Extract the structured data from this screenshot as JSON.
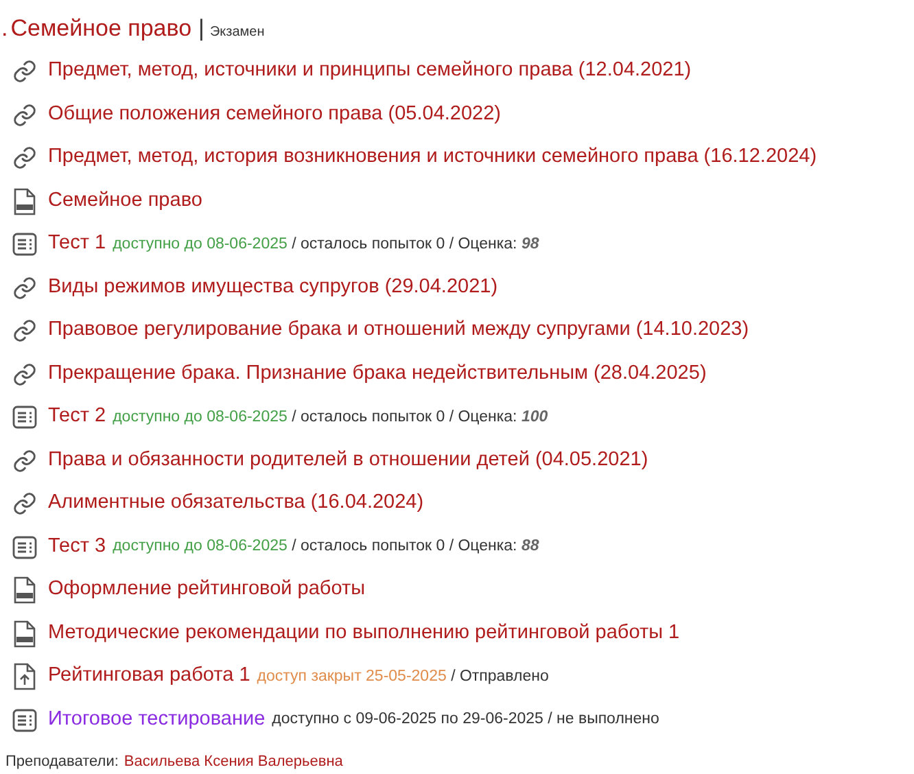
{
  "section": {
    "number": ".",
    "title": "Семейное право",
    "separator": "|",
    "type": "Экзамен"
  },
  "items": [
    {
      "kind": "link",
      "title": "Предмет, метод, источники и принципы семейного права (12.04.2021)",
      "visited": false
    },
    {
      "kind": "link",
      "title": "Общие положения семейного права (05.04.2022)",
      "visited": false
    },
    {
      "kind": "link",
      "title": "Предмет, метод, история возникновения и источники семейного права (16.12.2024)",
      "visited": false
    },
    {
      "kind": "pdf",
      "title": "Семейное право",
      "visited": false
    },
    {
      "kind": "quiz",
      "title": "Тест 1",
      "visited": false,
      "availability": {
        "text": "доступно до 08-06-2025",
        "color": "#43a047"
      },
      "status": "/ осталось попыток 0 / Оценка:",
      "grade": "98"
    },
    {
      "kind": "link",
      "title": "Виды режимов имущества супругов (29.04.2021)",
      "visited": false
    },
    {
      "kind": "link",
      "title": "Правовое регулирование брака и отношений между супругами (14.10.2023)",
      "visited": false
    },
    {
      "kind": "link",
      "title": "Прекращение брака. Признание брака недействительным (28.04.2025)",
      "visited": false
    },
    {
      "kind": "quiz",
      "title": "Тест 2",
      "visited": false,
      "availability": {
        "text": "доступно до 08-06-2025",
        "color": "#43a047"
      },
      "status": "/ осталось попыток 0 / Оценка:",
      "grade": "100"
    },
    {
      "kind": "link",
      "title": "Права и обязанности родителей в отношении детей (04.05.2021)",
      "visited": false
    },
    {
      "kind": "link",
      "title": "Алиментные обязательства (16.04.2024)",
      "visited": false
    },
    {
      "kind": "quiz",
      "title": "Тест 3",
      "visited": false,
      "availability": {
        "text": "доступно до 08-06-2025",
        "color": "#43a047"
      },
      "status": "/ осталось попыток 0 / Оценка:",
      "grade": "88"
    },
    {
      "kind": "doc",
      "title": "Оформление рейтинговой работы",
      "visited": false
    },
    {
      "kind": "doc",
      "title": "Методические рекомендации по выполнению рейтинговой работы 1",
      "visited": false
    },
    {
      "kind": "upload",
      "title": "Рейтинговая работа 1",
      "visited": false,
      "availability": {
        "text": "доступ закрыт 25-05-2025",
        "color": "#e08c4a"
      },
      "status": "/ Отправлено"
    },
    {
      "kind": "quiz",
      "title": "Итоговое тестирование",
      "visited": true,
      "availability": {
        "text": "доступно с 09-06-2025 по 29-06-2025",
        "color": "#333333"
      },
      "status": "/ не выполнено"
    }
  ],
  "teachers": {
    "label": "Преподаватели:",
    "names": "Васильева Ксения Валерьевна"
  }
}
